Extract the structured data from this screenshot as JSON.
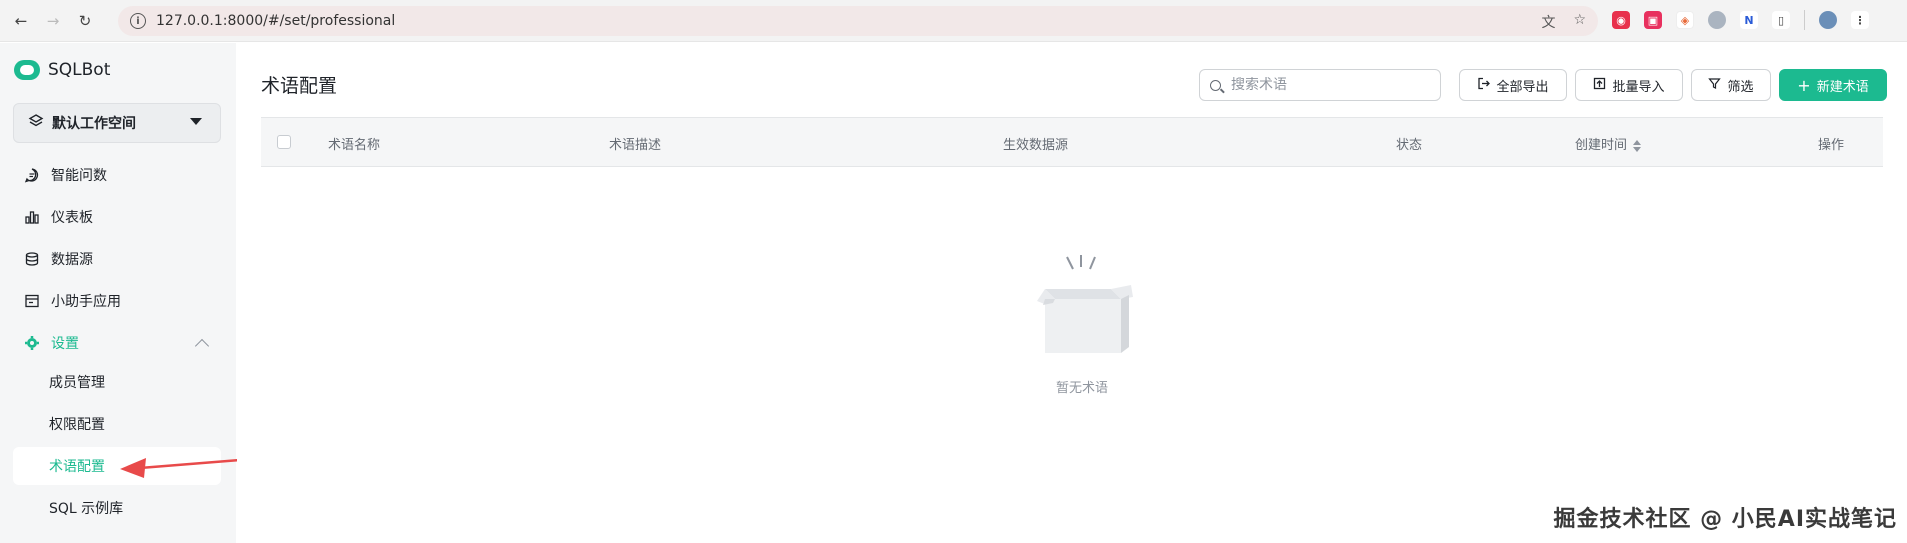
{
  "browser": {
    "url": "127.0.0.1:8000/#/set/professional"
  },
  "sidebar": {
    "app_name": "SQLBot",
    "workspace": "默认工作空间",
    "items": [
      {
        "label": "智能问数",
        "icon": "chat-icon"
      },
      {
        "label": "仪表板",
        "icon": "bar-chart-icon"
      },
      {
        "label": "数据源",
        "icon": "database-icon"
      },
      {
        "label": "小助手应用",
        "icon": "app-window-icon"
      }
    ],
    "settings": {
      "label": "设置",
      "icon": "gear-icon",
      "expanded": true,
      "children": [
        {
          "label": "成员管理",
          "active": false
        },
        {
          "label": "权限配置",
          "active": false
        },
        {
          "label": "术语配置",
          "active": true
        },
        {
          "label": "SQL 示例库",
          "active": false
        }
      ]
    }
  },
  "main": {
    "title": "术语配置",
    "search_placeholder": "搜索术语",
    "buttons": {
      "export_all": "全部导出",
      "batch_import": "批量导入",
      "filter": "筛选",
      "new_term": "新建术语"
    },
    "table": {
      "columns": [
        "术语名称",
        "术语描述",
        "生效数据源",
        "状态",
        "创建时间",
        "操作"
      ]
    },
    "empty_text": "暂无术语"
  },
  "watermark": "掘金技术社区 @ 小民AI实战笔记",
  "colors": {
    "accent": "#1cba90",
    "annotation_arrow": "#e84a4a"
  }
}
